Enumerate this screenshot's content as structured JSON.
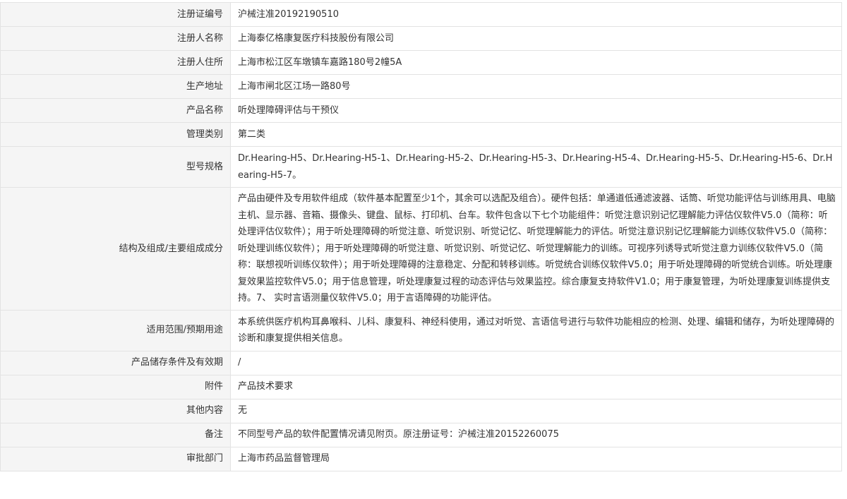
{
  "rows": [
    {
      "label": "注册证编号",
      "value": "沪械注准20192190510"
    },
    {
      "label": "注册人名称",
      "value": "上海泰亿格康复医疗科技股份有限公司"
    },
    {
      "label": "注册人住所",
      "value": "上海市松江区车墩镇车嘉路180号2幢5A"
    },
    {
      "label": "生产地址",
      "value": "上海市闸北区江场一路80号"
    },
    {
      "label": "产品名称",
      "value": "听处理障碍评估与干预仪"
    },
    {
      "label": "管理类别",
      "value": "第二类"
    },
    {
      "label": "型号规格",
      "value": "Dr.Hearing-H5、Dr.Hearing-H5-1、Dr.Hearing-H5-2、Dr.Hearing-H5-3、Dr.Hearing-H5-4、Dr.Hearing-H5-5、Dr.Hearing-H5-6、Dr.Hearing-H5-7。"
    },
    {
      "label": "结构及组成/主要组成成分",
      "value": "产品由硬件及专用软件组成（软件基本配置至少1个，其余可以选配及组合）。硬件包括：单通道低通滤波器、话筒、听觉功能评估与训练用具、电脑主机、显示器、音箱、摄像头、键盘、鼠标、打印机、台车。软件包含以下七个功能组件：听觉注意识别记忆理解能力评估仪软件V5.0（简称：听处理评估仪软件）；用于听处理障碍的听觉注意、听觉识别、听觉记忆、听觉理解能力的评估。听觉注意识别记忆理解能力训练仪软件V5.0（简称：听处理训练仪软件）；用于听处理障碍的听觉注意、听觉识别、听觉记忆、听觉理解能力的训练。可视序列诱导式听觉注意力训练仪软件V5.0（简称：联想视听训练仪软件）；用于听处理障碍的注意稳定、分配和转移训练。听觉统合训练仪软件V5.0；用于听处理障碍的听觉统合训练。听处理康复效果监控软件V5.0；用于信息管理，听处理康复过程的动态评估与效果监控。综合康复支持软件V1.0；用于康复管理，为听处理康复训练提供支持。7、 实时言语测量仪软件V5.0；用于言语障碍的功能评估。"
    },
    {
      "label": "适用范围/预期用途",
      "value": "本系统供医疗机构耳鼻喉科、儿科、康复科、神经科使用，通过对听觉、言语信号进行与软件功能相应的检测、处理、编辑和储存，为听处理障碍的诊断和康复提供相关信息。"
    },
    {
      "label": "产品储存条件及有效期",
      "value": "/"
    },
    {
      "label": "附件",
      "value": "产品技术要求"
    },
    {
      "label": "其他内容",
      "value": "无"
    },
    {
      "label": "备注",
      "value": "不同型号产品的软件配置情况请见附页。原注册证号：沪械注准20152260075"
    },
    {
      "label": "审批部门",
      "value": "上海市药品监督管理局"
    }
  ]
}
